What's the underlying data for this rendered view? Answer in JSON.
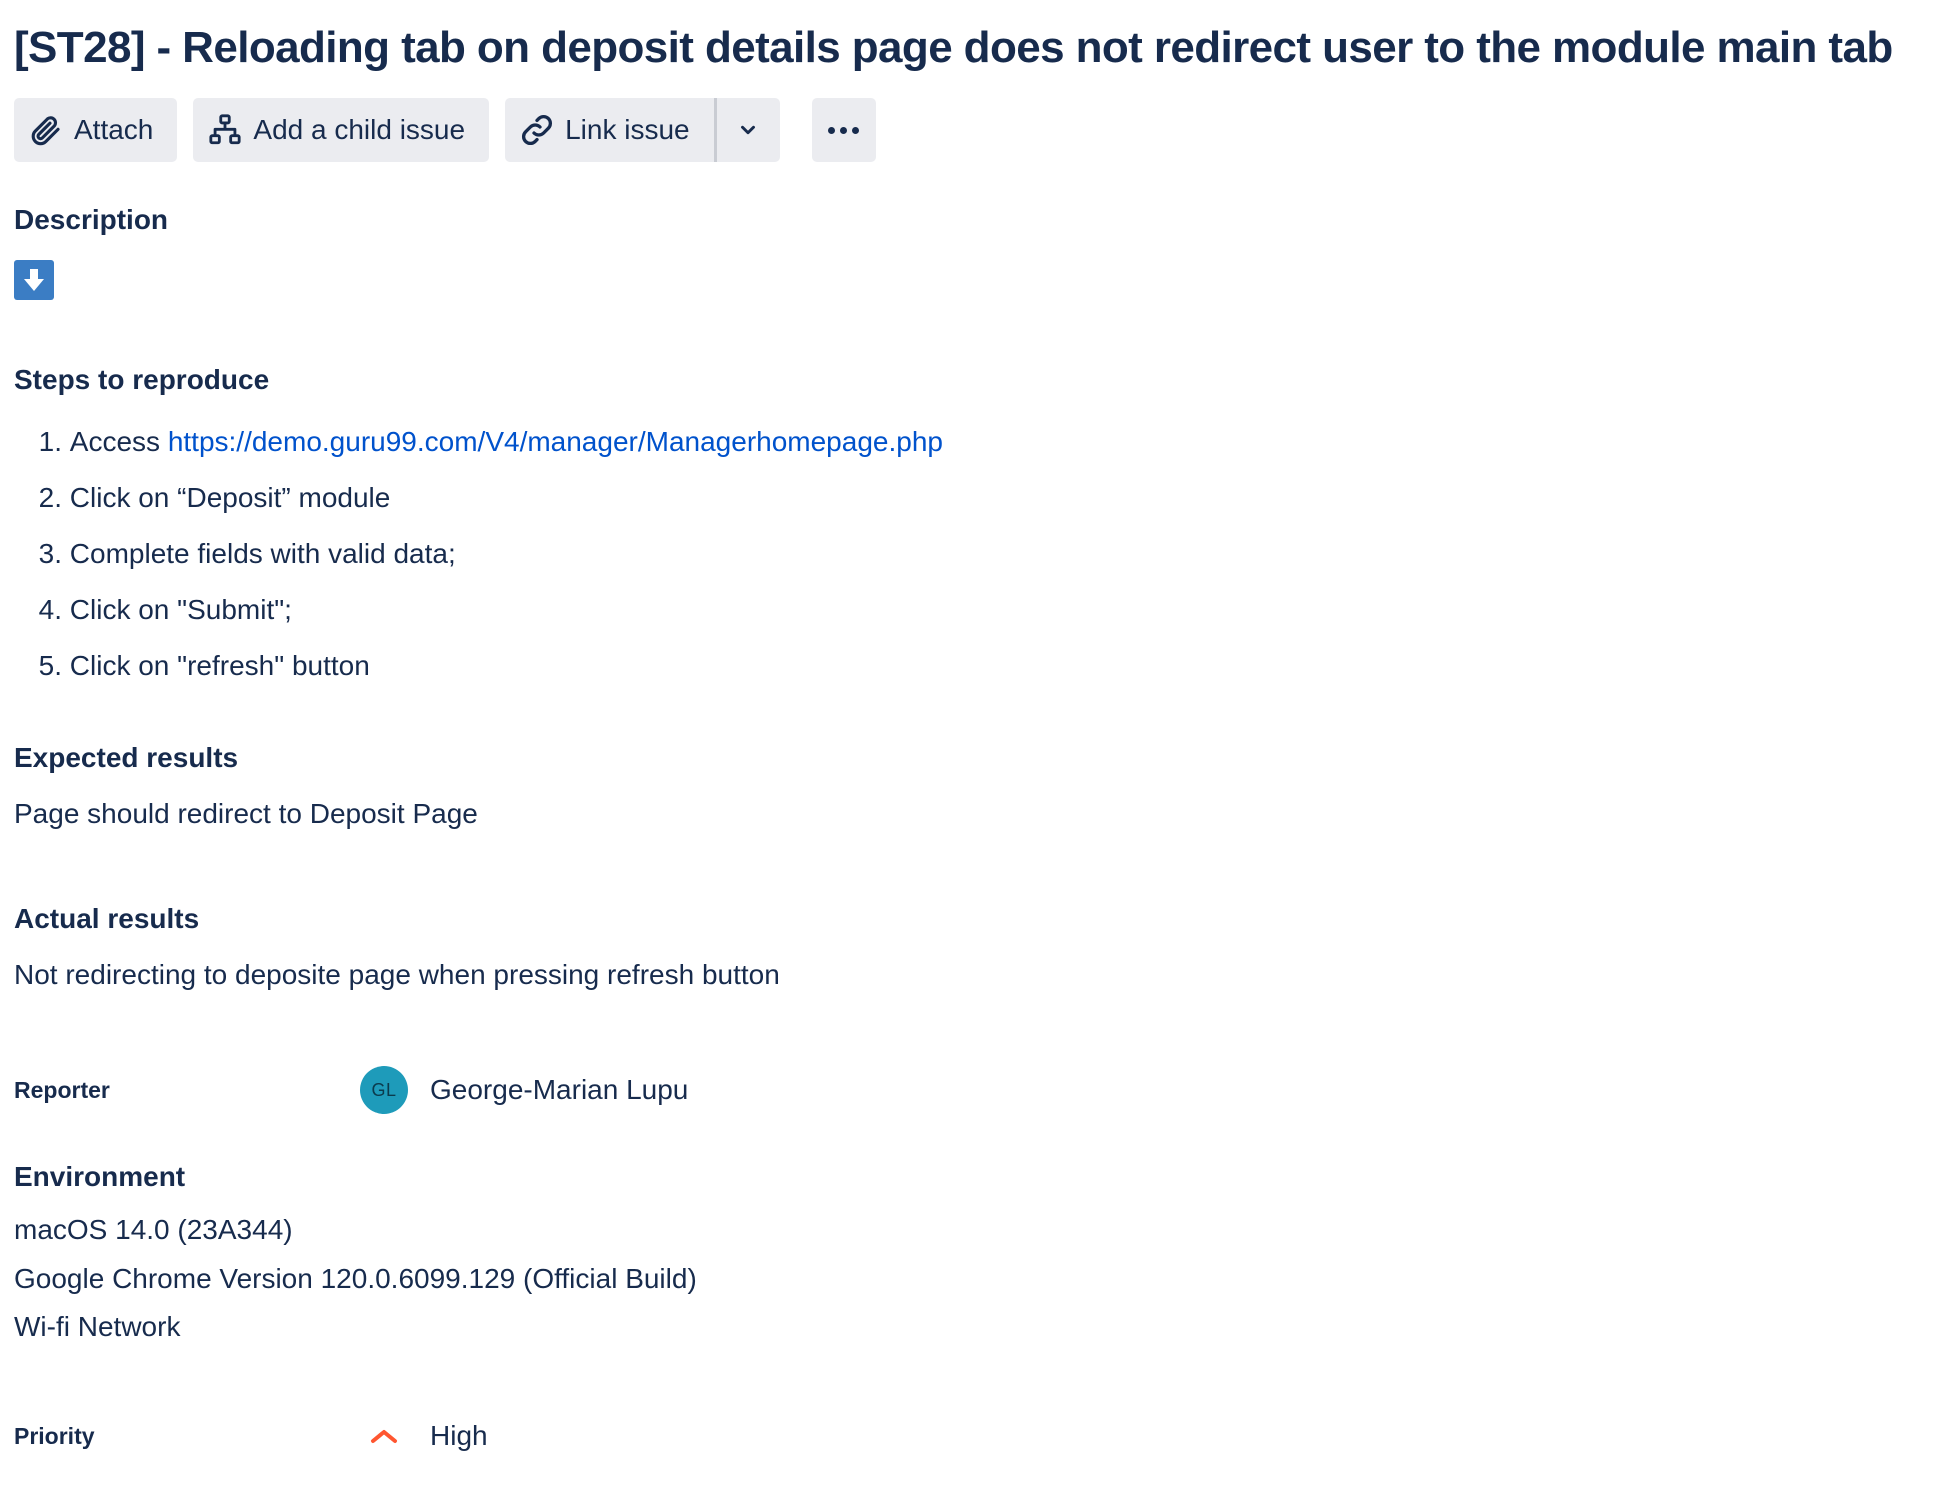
{
  "issue": {
    "title": "[ST28] - Reloading tab on deposit details page does not redirect user to the module main tab"
  },
  "toolbar": {
    "attach_label": "Attach",
    "child_label": "Add a child issue",
    "link_label": "Link issue",
    "attach_icon": "paperclip-icon",
    "child_icon": "hierarchy-icon",
    "link_icon": "link-icon",
    "dropdown_icon": "chevron-down-icon",
    "more_icon": "more-icon"
  },
  "description": {
    "label": "Description",
    "collapse_icon": "arrow-down-icon",
    "steps_heading": "Steps to reproduce",
    "steps": [
      {
        "num": "1.",
        "prefix": "Access ",
        "link": "https://demo.guru99.com/V4/manager/Managerhomepage.php"
      },
      {
        "num": "2.",
        "text": "Click on “Deposit” module"
      },
      {
        "num": "3.",
        "text": "Complete fields with valid data;"
      },
      {
        "num": "4.",
        "text": "Click on \"Submit\";"
      },
      {
        "num": "5.",
        "text": "Click on \"refresh\" button"
      }
    ],
    "expected_heading": "Expected results",
    "expected_text": "Page should redirect to Deposit Page",
    "actual_heading": "Actual results",
    "actual_text": "Not redirecting to deposite page when pressing refresh button"
  },
  "reporter": {
    "label": "Reporter",
    "initials": "GL",
    "name": "George-Marian Lupu",
    "avatar_color": "#1e9bba"
  },
  "environment": {
    "label": "Environment",
    "lines": [
      "macOS 14.0 (23A344)",
      "Google Chrome Version 120.0.6099.129 (Official Build)",
      "Wi-fi Network"
    ]
  },
  "priority": {
    "label": "Priority",
    "value": "High",
    "icon": "priority-high-icon",
    "color": "#ff5630"
  },
  "colors": {
    "text": "#172b4d",
    "link": "#0052cc",
    "button_bg": "#ebecf0",
    "download_icon_bg": "#3b7dc4"
  }
}
